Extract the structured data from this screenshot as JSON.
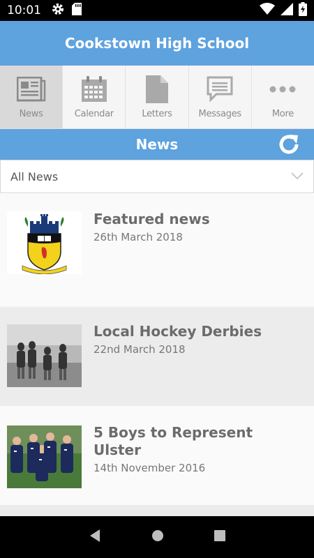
{
  "status": {
    "time": "10:01"
  },
  "header": {
    "title": "Cookstown High School"
  },
  "tabs": [
    {
      "label": "News",
      "icon": "newspaper-icon",
      "active": true
    },
    {
      "label": "Calendar",
      "icon": "calendar-icon",
      "active": false
    },
    {
      "label": "Letters",
      "icon": "document-icon",
      "active": false
    },
    {
      "label": "Messages",
      "icon": "message-icon",
      "active": false
    },
    {
      "label": "More",
      "icon": "more-icon",
      "active": false
    }
  ],
  "section": {
    "title": "News"
  },
  "filter": {
    "value": "All News"
  },
  "news": [
    {
      "title": "Featured news",
      "date": "26th March 2018",
      "thumb": "school-crest"
    },
    {
      "title": "Local Hockey Derbies",
      "date": "22nd March 2018",
      "thumb": "hockey-photo"
    },
    {
      "title": "5 Boys to Represent Ulster",
      "date": "14th November 2016",
      "thumb": "boys-photo"
    }
  ],
  "colors": {
    "accent": "#5ea2de",
    "tab_bg": "#f5f5f5",
    "tab_active": "#d9d9d9"
  }
}
